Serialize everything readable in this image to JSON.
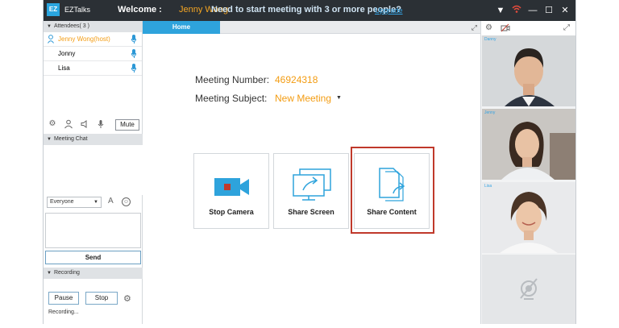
{
  "titlebar": {
    "logo_text": "EZ",
    "app_name": "EZTalks",
    "welcome_label": "Welcome :",
    "user_name": "Jenny Wong",
    "promo_text": "Need to start meeting with 3 or more people?",
    "upgrade_link": "Upgrade",
    "icons": [
      "dropdown-arrow-icon",
      "signal-icon",
      "minimize-icon",
      "maximize-icon",
      "close-icon"
    ]
  },
  "attendees": {
    "header": "Attendees( 3 )",
    "items": [
      {
        "name": "Jenny Wong(host)",
        "host": true
      },
      {
        "name": "Jonny",
        "host": false
      },
      {
        "name": "Lisa",
        "host": false
      }
    ],
    "mute_label": "Mute"
  },
  "chat": {
    "header": "Meeting Chat",
    "recipient": "Everyone",
    "send_label": "Send"
  },
  "recording": {
    "header": "Recording",
    "pause_label": "Pause",
    "stop_label": "Stop",
    "status": "Recording..."
  },
  "main": {
    "tab_label": "Home",
    "meeting_number_label": "Meeting Number:",
    "meeting_number": "46924318",
    "meeting_subject_label": "Meeting Subject:",
    "meeting_subject": "New Meeting",
    "actions": [
      {
        "label": "Stop Camera",
        "icon": "camera-icon"
      },
      {
        "label": "Share Screen",
        "icon": "share-screen-icon"
      },
      {
        "label": "Share Content",
        "icon": "share-content-icon"
      }
    ]
  },
  "videos": {
    "tiles": [
      {
        "name": "Danny"
      },
      {
        "name": "Jenny"
      },
      {
        "name": "Lisa"
      }
    ]
  },
  "colors": {
    "accent_blue": "#2ea3dc",
    "host_orange": "#f39c12",
    "highlight_red": "#c0392b",
    "titlebar_bg": "#2b3035"
  }
}
